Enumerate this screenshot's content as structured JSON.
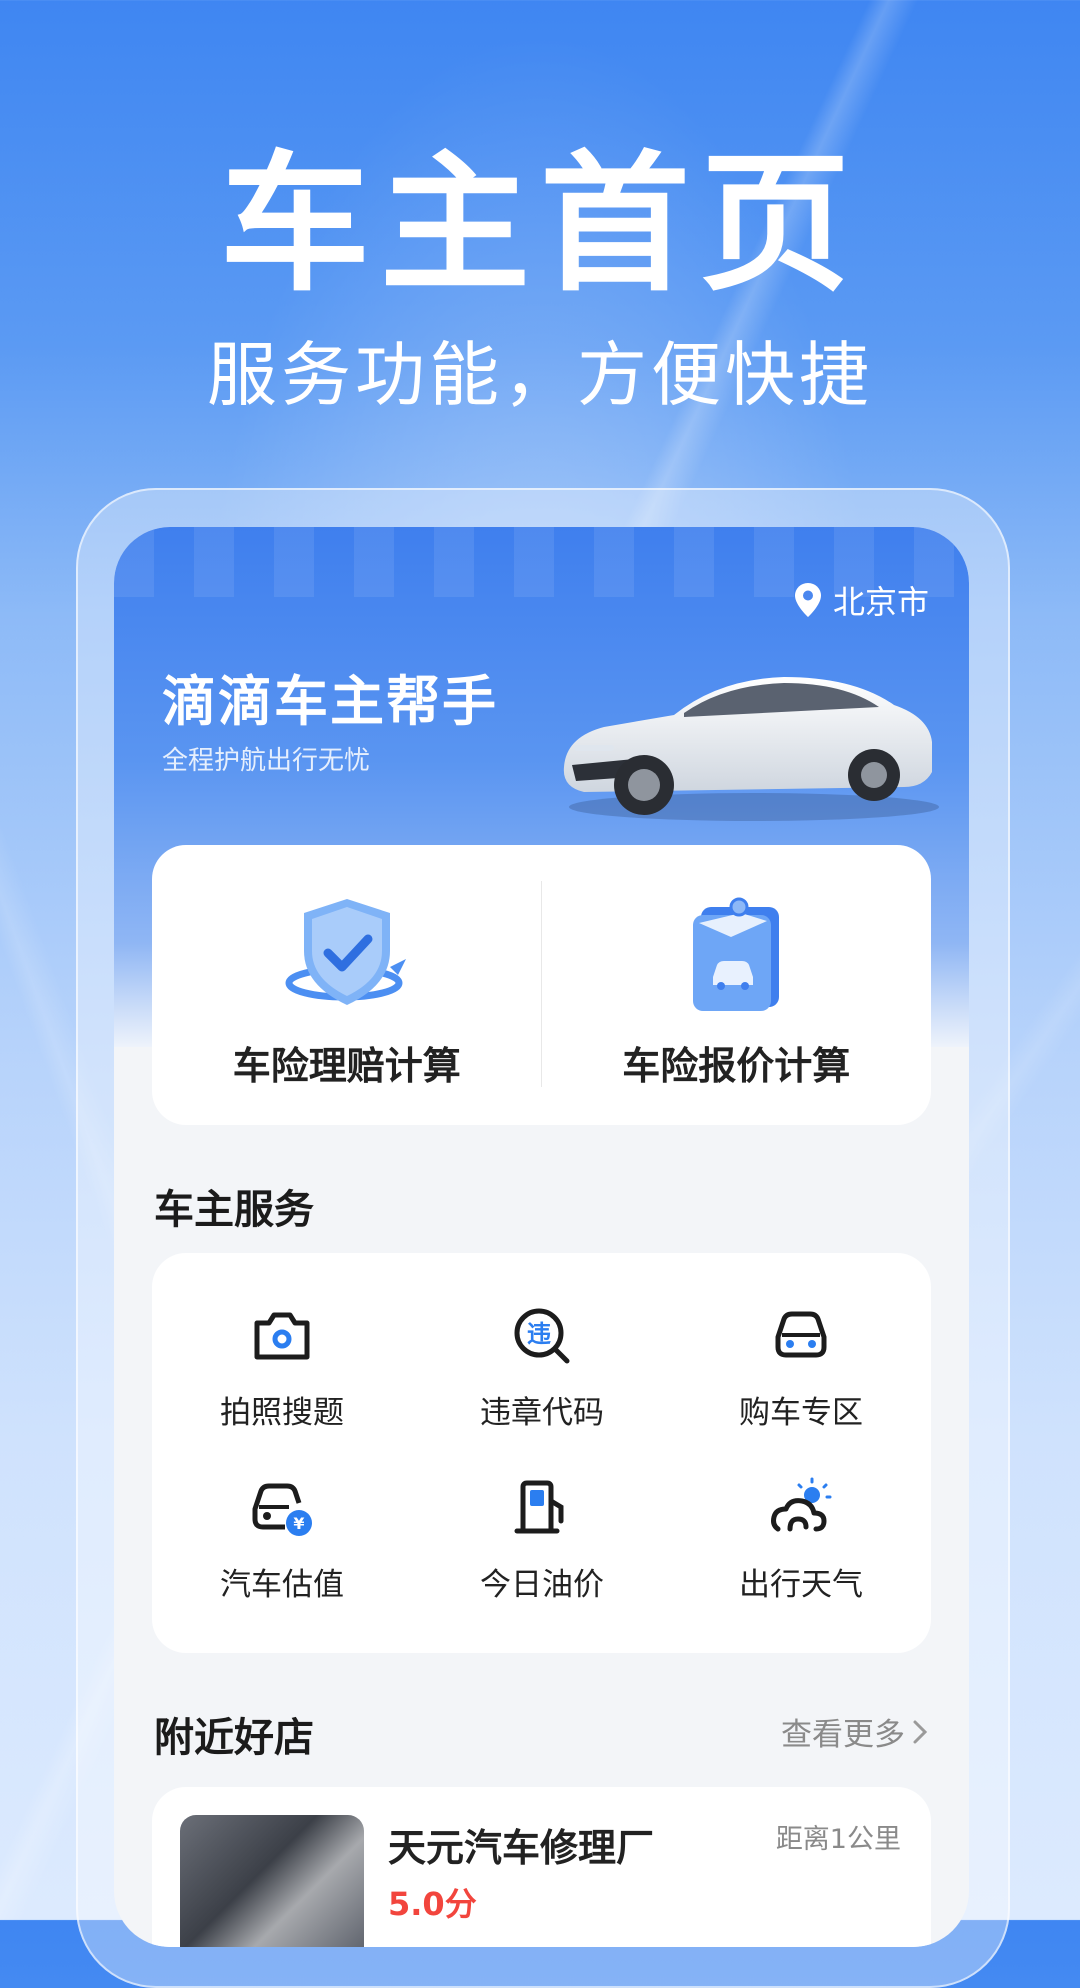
{
  "hero": {
    "title": "车主首页",
    "subtitle": "服务功能，方便快捷"
  },
  "app": {
    "location": "北京市",
    "name": "滴滴车主帮手",
    "tagline": "全程护航出行无忧"
  },
  "calculators": [
    {
      "label": "车险理赔计算",
      "icon": "shield-check-icon"
    },
    {
      "label": "车险报价计算",
      "icon": "clipboard-car-icon"
    }
  ],
  "services": {
    "title": "车主服务",
    "items": [
      {
        "label": "拍照搜题",
        "icon": "camera-icon"
      },
      {
        "label": "违章代码",
        "icon": "violation-search-icon"
      },
      {
        "label": "购车专区",
        "icon": "car-front-icon"
      },
      {
        "label": "汽车估值",
        "icon": "car-yen-icon"
      },
      {
        "label": "今日油价",
        "icon": "fuel-pump-icon"
      },
      {
        "label": "出行天气",
        "icon": "weather-icon"
      }
    ]
  },
  "nearby": {
    "title": "附近好店",
    "more": "查看更多",
    "shop": {
      "name": "天元汽车修理厂",
      "score": "5.0分",
      "distance": "距离1公里"
    }
  },
  "colors": {
    "accent": "#3f7fee",
    "score": "#f2453d"
  }
}
